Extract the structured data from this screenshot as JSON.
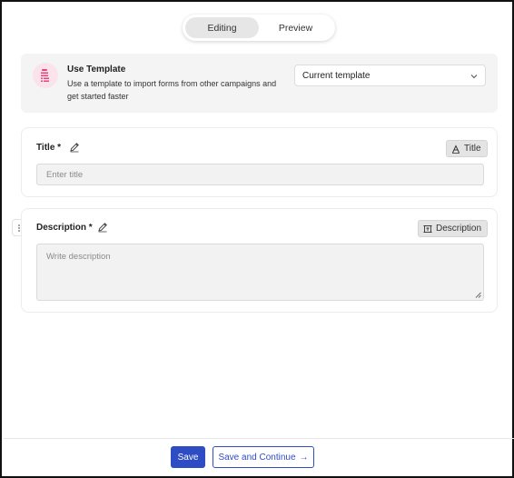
{
  "toggle": {
    "editing": "Editing",
    "preview": "Preview",
    "active": "editing"
  },
  "template": {
    "title": "Use Template",
    "description": "Use a template to import forms from other campaigns and get started faster",
    "select_value": "Current template"
  },
  "title_field": {
    "label": "Title",
    "required_mark": "*",
    "tag": "Title",
    "placeholder": "Enter title"
  },
  "description_field": {
    "label": "Description",
    "required_mark": "*",
    "tag": "Description",
    "placeholder": "Write description"
  },
  "footer": {
    "save_label": "Save",
    "continue_label": "Save and Continue",
    "continue_arrow": "→"
  },
  "colors": {
    "primary": "#2e4dc4",
    "card_bg": "#f4f4f4",
    "template_icon_accent": "#e8447a"
  }
}
